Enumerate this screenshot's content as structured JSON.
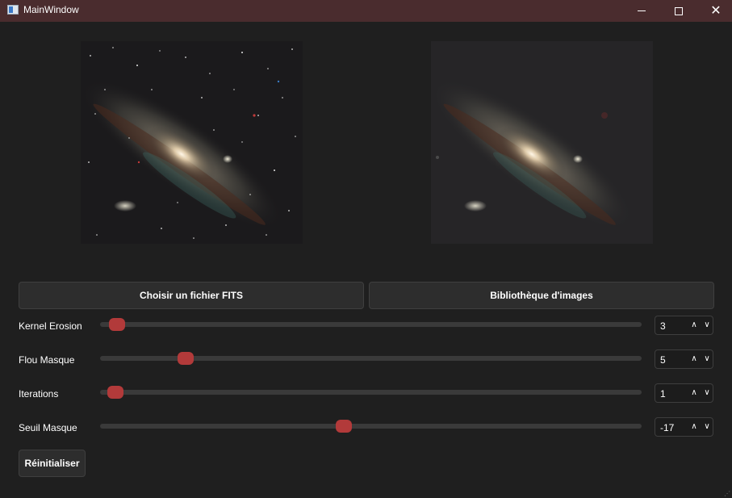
{
  "window": {
    "title": "MainWindow",
    "controls": {
      "minimize": "—",
      "maximize": "□",
      "close": "✕"
    }
  },
  "images": {
    "left": {
      "name": "original-galaxy-image",
      "icon": "galaxy-image"
    },
    "right": {
      "name": "processed-galaxy-image",
      "icon": "galaxy-image"
    }
  },
  "buttons": {
    "choose_fits": "Choisir un fichier FITS",
    "library": "Bibliothèque d'images",
    "reset": "Réinitialiser"
  },
  "sliders": [
    {
      "label": "Kernel Erosion",
      "value": "3",
      "fraction": 0.017
    },
    {
      "label": "Flou Masque",
      "value": "5",
      "fraction": 0.147
    },
    {
      "label": "Iterations",
      "value": "1",
      "fraction": 0.014
    },
    {
      "label": "Seuil Masque",
      "value": "-17",
      "fraction": 0.448
    }
  ],
  "spin_icons": {
    "up": "chevron-up-icon",
    "down": "chevron-down-icon"
  },
  "colors": {
    "titlebar": "#4a2c2e",
    "background": "#1f1f1f",
    "slider_handle": "#b23a3a",
    "slider_track": "#3a3a3a"
  }
}
